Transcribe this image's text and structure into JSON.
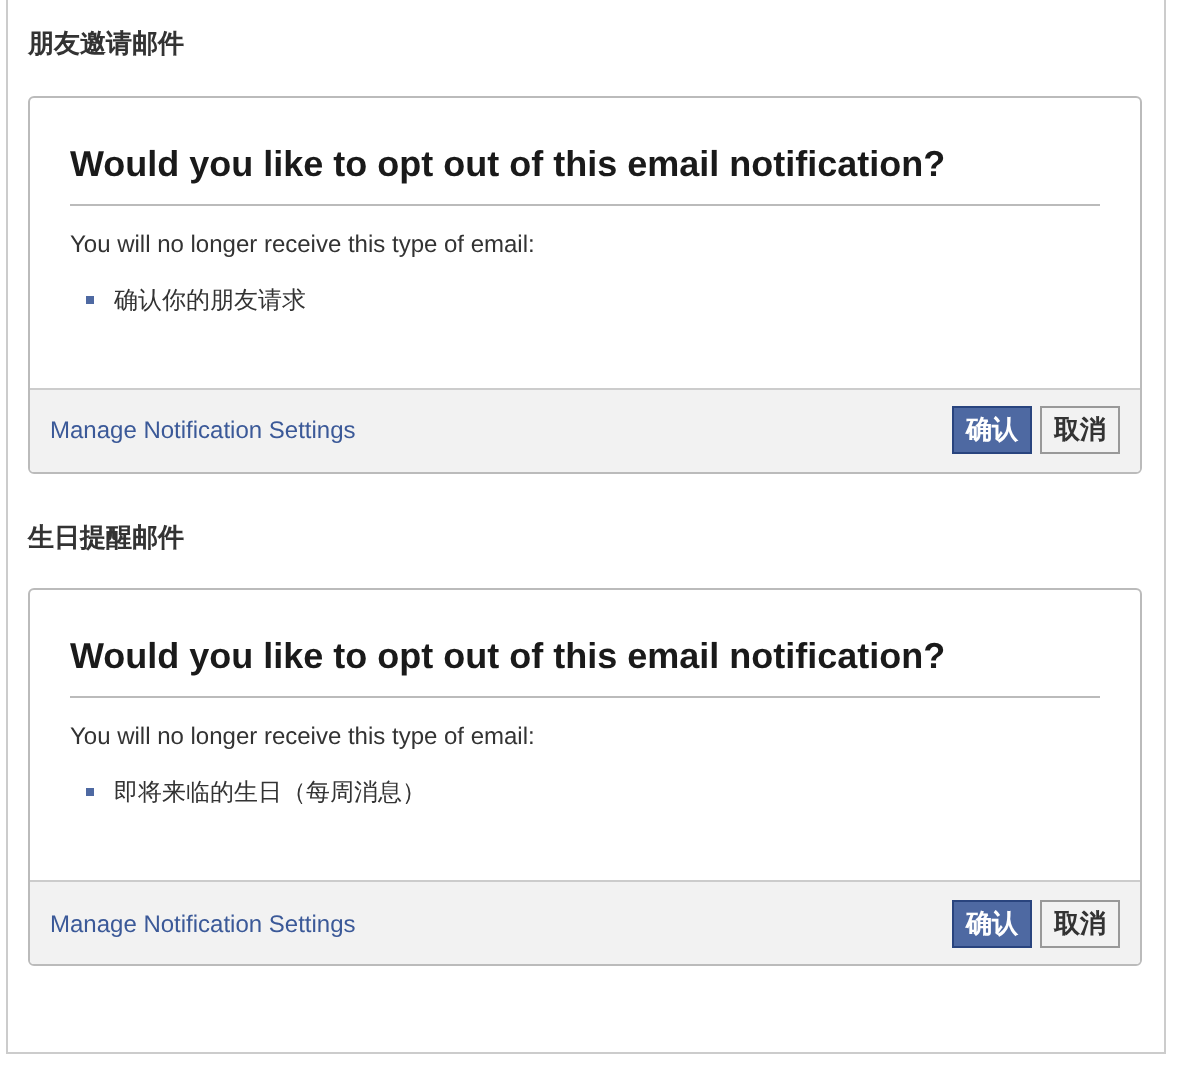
{
  "sections": [
    {
      "heading": "朋友邀请邮件",
      "title": "Would you like to opt out of this email notification?",
      "message": "You will no longer receive this type of email:",
      "items": [
        "确认你的朋友请求"
      ],
      "link": "Manage Notification Settings",
      "buttons": [
        {
          "label": "确认",
          "kind": "primary"
        },
        {
          "label": "取消",
          "kind": "secondary"
        }
      ]
    },
    {
      "heading": "生日提醒邮件",
      "title": "Would you like to opt out of this email notification?",
      "message": "You will no longer receive this type of email:",
      "items": [
        "即将来临的生日（每周消息）"
      ],
      "link": "Manage Notification Settings",
      "buttons": [
        {
          "label": "确认",
          "kind": "primary"
        },
        {
          "label": "取消",
          "kind": "secondary"
        }
      ]
    }
  ]
}
